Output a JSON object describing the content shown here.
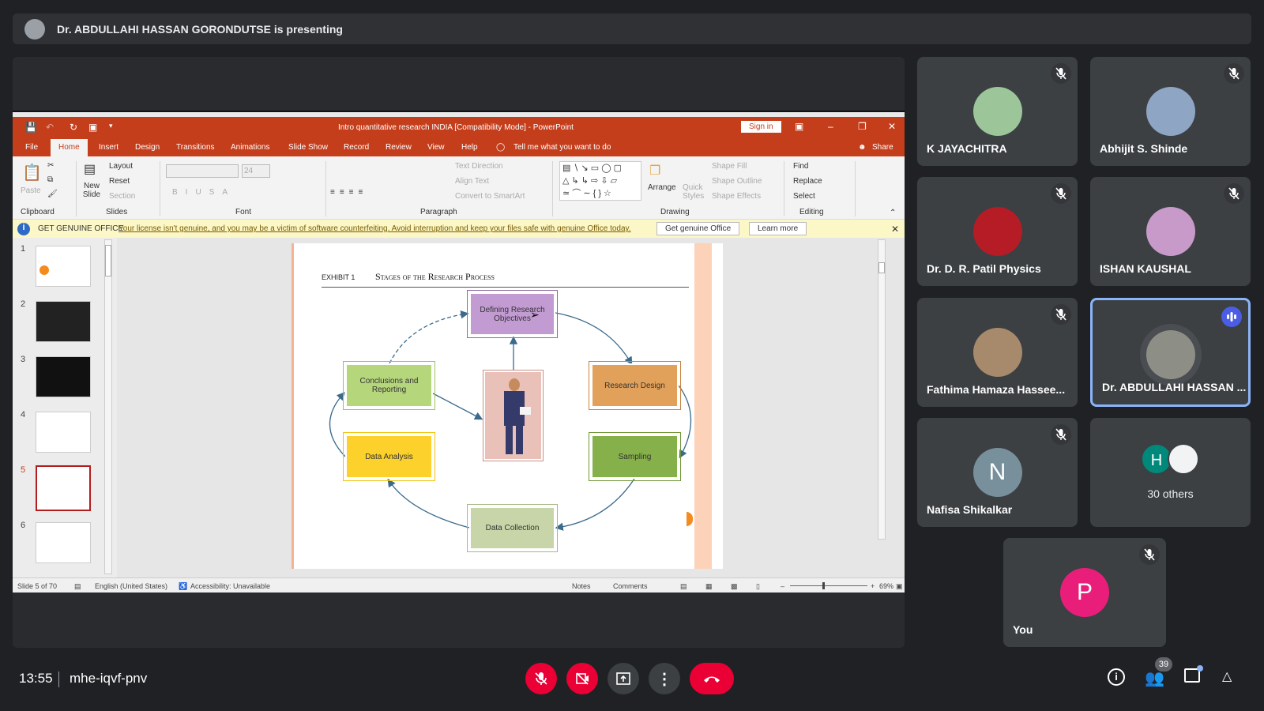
{
  "meet": {
    "presenting_banner": "Dr. ABDULLAHI HASSAN GORONDUTSE is presenting",
    "time": "13:55",
    "meeting_code": "mhe-iqvf-pnv",
    "participant_count": "39",
    "others_label": "30 others",
    "others_avatar_letter": "H"
  },
  "participants": [
    {
      "name": "K JAYACHITRA",
      "muted": true,
      "avatar_color": "#9cc59a"
    },
    {
      "name": "Abhijit S. Shinde",
      "muted": true,
      "avatar_color": "#8ea5c4"
    },
    {
      "name": "Dr. D. R. Patil Physics",
      "muted": true,
      "avatar_color": "#b51c25"
    },
    {
      "name": "ISHAN KAUSHAL",
      "muted": true,
      "avatar_color": "#c79ac9"
    },
    {
      "name": "Fathima Hamaza Hassee...",
      "muted": true,
      "avatar_color": "#a78a6c"
    },
    {
      "name": "Dr. ABDULLAHI HASSAN ...",
      "muted": false,
      "speaking": true,
      "avatar_color": "#8d8f86"
    },
    {
      "name": "Nafisa Shikalkar",
      "muted": true,
      "avatar_letter": "N",
      "avatar_color": "#78909c"
    },
    {
      "name": "You",
      "muted": true,
      "avatar_letter": "P",
      "avatar_color": "#e91e7b"
    }
  ],
  "colors": {
    "ppt_accent": "#c43e1c",
    "meet_red": "#ea0034",
    "active_border": "#8ab4f8"
  },
  "ppt": {
    "title": "Intro quantitative research INDIA [Compatibility Mode]  -  PowerPoint",
    "sign_in": "Sign in",
    "share": "Share",
    "tabs": [
      "File",
      "Home",
      "Insert",
      "Design",
      "Transitions",
      "Animations",
      "Slide Show",
      "Record",
      "Review",
      "View",
      "Help"
    ],
    "tell_me": "Tell me what you want to do",
    "ribbon": {
      "paste": "Paste",
      "new_slide": "New Slide",
      "layout": "Layout",
      "reset": "Reset",
      "section": "Section",
      "font_size": "24",
      "text_direction": "Text Direction",
      "align_text": "Align Text",
      "convert_smartart": "Convert to SmartArt",
      "arrange": "Arrange",
      "quick_styles": "Quick Styles",
      "shape_fill": "Shape Fill",
      "shape_outline": "Shape Outline",
      "shape_effects": "Shape Effects",
      "find": "Find",
      "replace": "Replace",
      "select": "Select",
      "groups": [
        "Clipboard",
        "Slides",
        "Font",
        "Paragraph",
        "Drawing",
        "Editing"
      ]
    },
    "genuine": {
      "label": "GET GENUINE OFFICE",
      "message": "Your license isn't genuine, and you may be a victim of software counterfeiting. Avoid interruption and keep your files safe with genuine Office today.",
      "get_button": "Get genuine Office",
      "learn_button": "Learn more"
    },
    "thumbnails": [
      "1",
      "2",
      "3",
      "4",
      "5",
      "6"
    ],
    "selected_slide": 5,
    "slide": {
      "exhibit": "EXHIBIT 1",
      "heading": "Stages of the Research Process",
      "boxes": {
        "defining": "Defining Research Objectives",
        "design": "Research Design",
        "sampling": "Sampling",
        "collection": "Data Collection",
        "analysis": "Data Analysis",
        "conclusions": "Conclusions and Reporting"
      }
    },
    "status": {
      "slide": "Slide 5 of 70",
      "language": "English (United States)",
      "accessibility": "Accessibility: Unavailable",
      "notes": "Notes",
      "comments": "Comments",
      "zoom": "69%",
      "zoom_level": 69
    }
  }
}
